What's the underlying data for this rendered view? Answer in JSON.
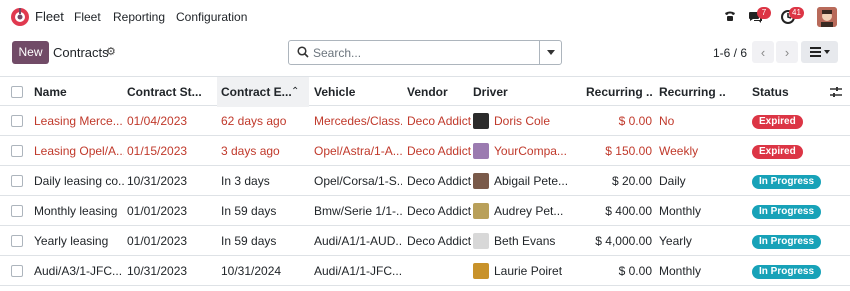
{
  "nav": {
    "app_name": "Fleet",
    "menu": [
      "Fleet",
      "Reporting",
      "Configuration"
    ],
    "messages_count": "7",
    "activities_count": "41"
  },
  "control": {
    "new_label": "New",
    "title": "Contracts",
    "search_placeholder": "Search...",
    "pager": "1-6 / 6"
  },
  "table": {
    "headers": [
      "Name",
      "Contract St...",
      "Contract E...",
      "Vehicle",
      "Vendor",
      "Driver",
      "Recurring ...",
      "Recurring ...",
      "Status"
    ],
    "rows": [
      {
        "name": "Leasing Merce...",
        "start": "01/04/2023",
        "end": "62 days ago",
        "vehicle": "Mercedes/Class...",
        "vendor": "Deco Addict",
        "driver": "Doris Cole",
        "cost": "$ 0.00",
        "freq": "No",
        "status": "Expired",
        "overdue": true,
        "avatar_color": "#2b2b2b"
      },
      {
        "name": "Leasing Opel/A...",
        "start": "01/15/2023",
        "end": "3 days ago",
        "vehicle": "Opel/Astra/1-A...",
        "vendor": "Deco Addict",
        "driver": "YourCompa...",
        "cost": "$ 150.00",
        "freq": "Weekly",
        "status": "Expired",
        "overdue": true,
        "avatar_color": "#9b7bb0"
      },
      {
        "name": "Daily leasing co...",
        "start": "10/31/2023",
        "end": "In 3 days",
        "vehicle": "Opel/Corsa/1-S...",
        "vendor": "Deco Addict",
        "driver": "Abigail Pete...",
        "cost": "$ 20.00",
        "freq": "Daily",
        "status": "In Progress",
        "overdue": false,
        "avatar_color": "#7a5a4a"
      },
      {
        "name": "Monthly leasing",
        "start": "01/01/2023",
        "end": "In 59 days",
        "vehicle": "Bmw/Serie 1/1-...",
        "vendor": "Deco Addict",
        "driver": "Audrey Pet...",
        "cost": "$ 400.00",
        "freq": "Monthly",
        "status": "In Progress",
        "overdue": false,
        "avatar_color": "#b9a05a"
      },
      {
        "name": "Yearly leasing",
        "start": "01/01/2023",
        "end": "In 59 days",
        "vehicle": "Audi/A1/1-AUD...",
        "vendor": "Deco Addict",
        "driver": "Beth Evans",
        "cost": "$ 4,000.00",
        "freq": "Yearly",
        "status": "In Progress",
        "overdue": false,
        "avatar_color": "#d8d8d8"
      },
      {
        "name": "Audi/A3/1-JFC...",
        "start": "10/31/2023",
        "end": "10/31/2024",
        "vehicle": "Audi/A1/1-JFC...",
        "vendor": "",
        "driver": "Laurie Poiret",
        "cost": "$ 0.00",
        "freq": "Monthly",
        "status": "In Progress",
        "overdue": false,
        "avatar_color": "#c8922a"
      }
    ]
  },
  "colors": {
    "brand": "#714b67",
    "expired": "#dc3545",
    "in_progress": "#17a2b8",
    "overdue_text": "#c0392b"
  }
}
